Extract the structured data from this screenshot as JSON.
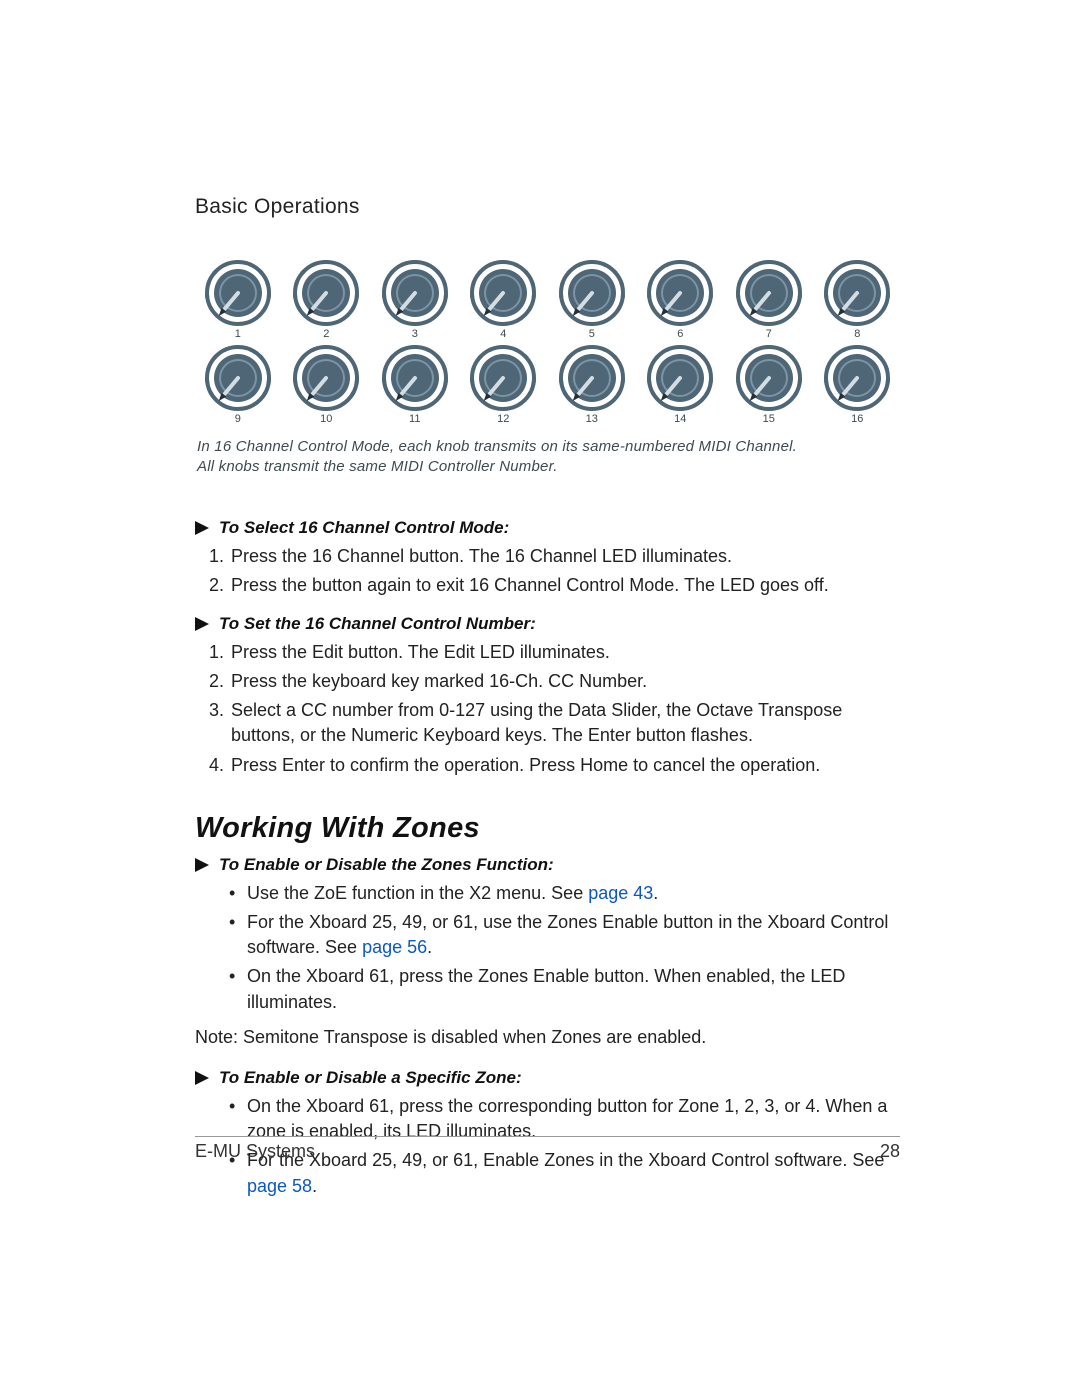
{
  "section_title": "Basic Operations",
  "knob_rows": {
    "row1": [
      "1",
      "2",
      "3",
      "4",
      "5",
      "6",
      "7",
      "8"
    ],
    "row2": [
      "9",
      "10",
      "11",
      "12",
      "13",
      "14",
      "15",
      "16"
    ]
  },
  "caption_line1": "In 16 Channel Control Mode, each knob transmits on its same-numbered MIDI Channel.",
  "caption_line2": "All knobs transmit the same MIDI Controller Number.",
  "proc1": {
    "heading": "To Select 16 Channel Control Mode:",
    "items": [
      "Press the 16 Channel button. The 16 Channel LED illuminates.",
      "Press the button again to exit 16 Channel Control Mode. The LED goes off."
    ]
  },
  "proc2": {
    "heading": "To Set the 16 Channel Control Number:",
    "items": [
      "Press the Edit button. The Edit LED illuminates.",
      "Press the keyboard key marked 16-Ch. CC Number.",
      "Select a CC number from 0-127 using the Data Slider, the Octave Transpose buttons, or the Numeric Keyboard keys. The Enter button flashes.",
      "Press Enter to confirm the operation. Press Home to cancel the operation."
    ]
  },
  "h2": "Working With Zones",
  "proc3": {
    "heading": "To Enable or Disable the Zones Function:",
    "items": [
      {
        "pre": "Use the ZoE function in the X2 menu. See ",
        "link": "page 43",
        "post": "."
      },
      {
        "pre": "For the Xboard 25, 49, or 61, use the Zones Enable button in the Xboard Control software. See ",
        "link": "page 56",
        "post": "."
      },
      {
        "pre": "On the Xboard 61, press the Zones Enable button. When enabled, the LED illuminates.",
        "link": "",
        "post": ""
      }
    ]
  },
  "note": "Note: Semitone Transpose is disabled when Zones are enabled.",
  "proc4": {
    "heading": "To Enable or Disable a Specific Zone:",
    "items": [
      {
        "pre": "On the Xboard 61, press the corresponding button for Zone 1, 2, 3, or 4. When a zone is enabled, its LED illuminates.",
        "link": "",
        "post": ""
      },
      {
        "pre": "For the Xboard 25, 49, or 61, Enable Zones in the Xboard Control software. See ",
        "link": "page 58",
        "post": "."
      }
    ]
  },
  "footer": {
    "left": "E-MU Systems",
    "right": "28"
  },
  "icons": {
    "triangle": "triangle-right-icon",
    "knob": "knob-icon"
  }
}
